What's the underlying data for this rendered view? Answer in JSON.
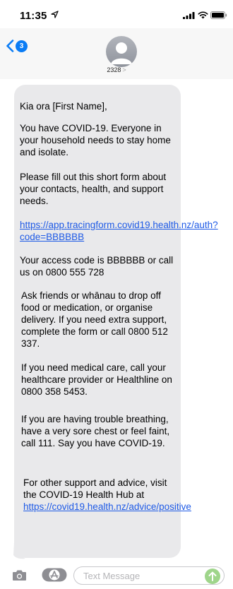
{
  "status_bar": {
    "time": "11:35",
    "location_icon": "location-arrow-icon",
    "signal_icon": "cellular-signal-icon",
    "wifi_icon": "wifi-icon",
    "battery_icon": "battery-icon"
  },
  "header": {
    "back_icon": "chevron-left-icon",
    "unread_count": "3",
    "contact_name": "2328",
    "contact_chevron": ">"
  },
  "message": {
    "greeting": "Kia ora  [First Name],",
    "p_isolate": "You have COVID-19. Everyone in your household needs to stay home and isolate.",
    "p_form": "Please fill out this short form about your contacts, health, and support needs.",
    "link_form": "https://app.tracingform.covid19.health.nz/auth?code=BBBBBB",
    "p_code": "Your access code is BBBBBB or call us on 0800 555 728",
    "p_whanau": "Ask friends or whānau to drop off food or medication, or organise delivery. If you need extra support, complete the form or call 0800 512 337.",
    "p_medical": "If you need medical care, call your healthcare provider or Healthline on 0800 358 5453.",
    "p_breathing": "If you are having trouble breathing, have a very sore chest or feel faint, call 111.  Say you have COVID-19.",
    "p_support_prefix": "For other support and advice, visit the COVID-19 Health Hub at ",
    "link_hub": "https://covid19.health.nz/advice/positive"
  },
  "input_bar": {
    "camera_icon": "camera-icon",
    "apps_icon": "app-store-icon",
    "placeholder": "Text Message",
    "send_icon": "arrow-up-icon"
  },
  "colors": {
    "bubble": "#e9e9eb",
    "link": "#1e5ae6",
    "accent": "#0a7cf5",
    "send_disabled": "#9fd58b"
  }
}
